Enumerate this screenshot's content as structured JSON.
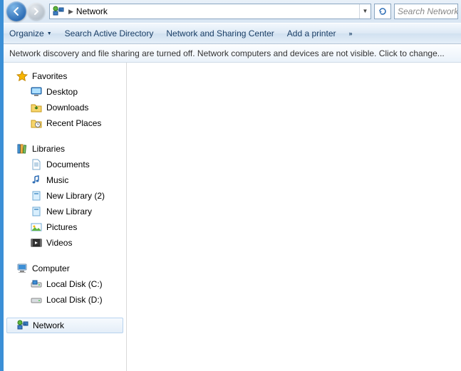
{
  "address": {
    "location": "Network"
  },
  "search": {
    "placeholder": "Search Network"
  },
  "toolbar": {
    "organize": "Organize",
    "search_ad": "Search Active Directory",
    "net_sharing": "Network and Sharing Center",
    "add_printer": "Add a printer",
    "overflow": "»"
  },
  "info_bar": "Network discovery and file sharing are turned off. Network computers and devices are not visible. Click to change...",
  "tree": {
    "favorites": {
      "label": "Favorites",
      "items": [
        "Desktop",
        "Downloads",
        "Recent Places"
      ]
    },
    "libraries": {
      "label": "Libraries",
      "items": [
        "Documents",
        "Music",
        "New Library (2)",
        "New Library",
        "Pictures",
        "Videos"
      ]
    },
    "computer": {
      "label": "Computer",
      "items": [
        "Local Disk (C:)",
        "Local Disk (D:)"
      ]
    },
    "network": {
      "label": "Network"
    }
  }
}
